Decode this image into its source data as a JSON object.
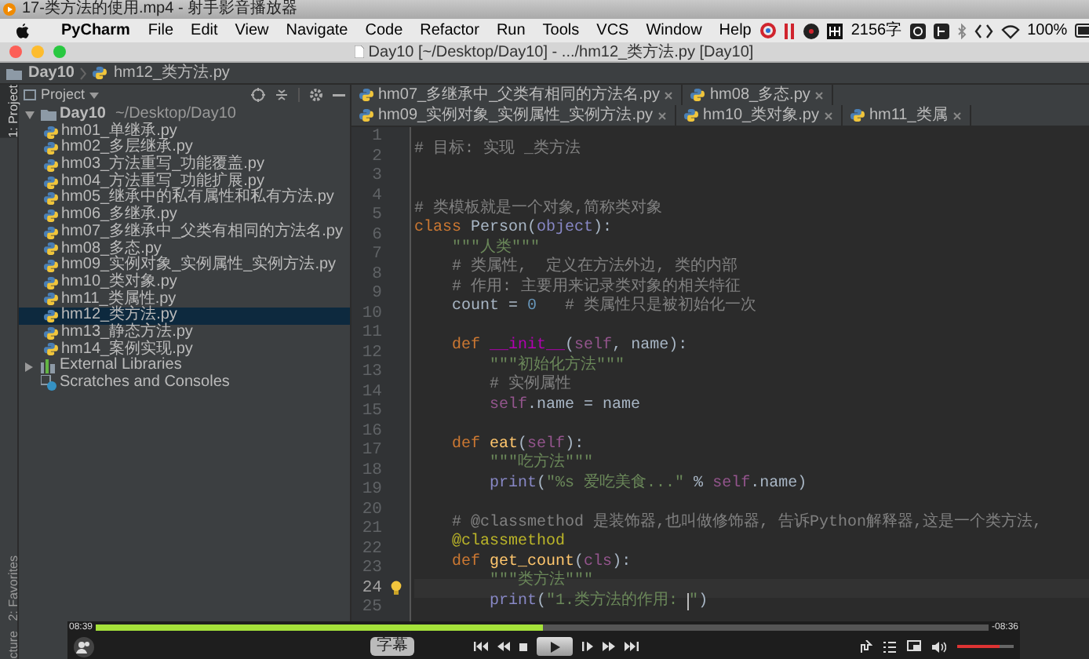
{
  "player_title": "17-类方法的使用.mp4 - 射手影音播放器",
  "menu_bar": {
    "app": "PyCharm",
    "items": [
      "File",
      "Edit",
      "View",
      "Navigate",
      "Code",
      "Refactor",
      "Run",
      "Tools",
      "VCS",
      "Window",
      "Help"
    ],
    "word_count": "2156字",
    "battery": "100%"
  },
  "window": {
    "title": "Day10 [~/Desktop/Day10] - .../hm12_类方法.py [Day10]"
  },
  "breadcrumbs": [
    "Day10",
    "hm12_类方法.py"
  ],
  "side_strip": [
    {
      "label": "1: Project",
      "selected": true
    },
    {
      "label": "2: Favorites",
      "selected": false
    },
    {
      "label": "cture",
      "selected": false
    }
  ],
  "project_panel": {
    "title": "Project",
    "tree": [
      {
        "kind": "folder",
        "label": "Day10",
        "path": "~/Desktop/Day10",
        "expanded": true,
        "selected": false,
        "children": [
          {
            "kind": "python",
            "label": "hm01_单继承.py",
            "selected": false
          },
          {
            "kind": "python",
            "label": "hm02_多层继承.py",
            "selected": false
          },
          {
            "kind": "python",
            "label": "hm03_方法重写_功能覆盖.py",
            "selected": false
          },
          {
            "kind": "python",
            "label": "hm04_方法重写_功能扩展.py",
            "selected": false
          },
          {
            "kind": "python",
            "label": "hm05_继承中的私有属性和私有方法.py",
            "selected": false
          },
          {
            "kind": "python",
            "label": "hm06_多继承.py",
            "selected": false
          },
          {
            "kind": "python",
            "label": "hm07_多继承中_父类有相同的方法名.py",
            "selected": false
          },
          {
            "kind": "python",
            "label": "hm08_多态.py",
            "selected": false
          },
          {
            "kind": "python",
            "label": "hm09_实例对象_实例属性_实例方法.py",
            "selected": false
          },
          {
            "kind": "python",
            "label": "hm10_类对象.py",
            "selected": false
          },
          {
            "kind": "python",
            "label": "hm11_类属性.py",
            "selected": false
          },
          {
            "kind": "python",
            "label": "hm12_类方法.py",
            "selected": true
          },
          {
            "kind": "python",
            "label": "hm13_静态方法.py",
            "selected": false
          },
          {
            "kind": "python",
            "label": "hm14_案例实现.py",
            "selected": false
          }
        ]
      },
      {
        "kind": "library",
        "label": "External Libraries",
        "expanded": false,
        "selected": false
      },
      {
        "kind": "scratches",
        "label": "Scratches and Consoles",
        "selected": false
      }
    ]
  },
  "editor_tabs": [
    {
      "label": "hm07_多继承中_父类有相同的方法名.py",
      "selected": false
    },
    {
      "label": "hm08_多态.py",
      "selected": false
    },
    {
      "label": "hm09_实例对象_实例属性_实例方法.py",
      "selected": false
    },
    {
      "label": "hm10_类对象.py",
      "selected": false
    },
    {
      "label": "hm11_类属",
      "selected": false
    }
  ],
  "code_lines": [
    {
      "number": "1",
      "current": false,
      "tokens": [
        {
          "kind": "comment",
          "text": "# 目标: 实现 _类方法"
        }
      ]
    },
    {
      "number": "2",
      "current": false
    },
    {
      "number": "3",
      "current": false
    },
    {
      "number": "4",
      "current": false,
      "tokens": [
        {
          "kind": "comment",
          "text": "# 类模板就是一个对象,简称类对象"
        }
      ]
    },
    {
      "number": "5",
      "current": false,
      "tokens": [
        {
          "kind": "keyword",
          "text": "class"
        },
        {
          "kind": "plain",
          "text": " Person("
        },
        {
          "kind": "builtin",
          "text": "object"
        },
        {
          "kind": "plain",
          "text": "):"
        }
      ]
    },
    {
      "number": "6",
      "current": false,
      "tokens": [
        {
          "kind": "string",
          "text": "    \"\"\"人类\"\"\""
        }
      ]
    },
    {
      "number": "7",
      "current": false,
      "tokens": [
        {
          "kind": "comment",
          "text": "    # 类属性,  定义在方法外边, 类的内部"
        }
      ]
    },
    {
      "number": "8",
      "current": false,
      "tokens": [
        {
          "kind": "comment",
          "text": "    # 作用: 主要用来记录类对象的相关特征"
        }
      ]
    },
    {
      "number": "9",
      "current": false,
      "tokens": [
        {
          "kind": "plain",
          "text": "    count = "
        },
        {
          "kind": "number",
          "text": "0"
        },
        {
          "kind": "comment",
          "text": "   # 类属性只是被初始化一次"
        }
      ]
    },
    {
      "number": "10",
      "current": false
    },
    {
      "number": "11",
      "current": false,
      "tokens": [
        {
          "kind": "keyword",
          "text": "    def "
        },
        {
          "kind": "magic",
          "text": "__init__"
        },
        {
          "kind": "plain",
          "text": "("
        },
        {
          "kind": "self",
          "text": "self"
        },
        {
          "kind": "plain",
          "text": ", name):"
        }
      ]
    },
    {
      "number": "12",
      "current": false,
      "tokens": [
        {
          "kind": "string",
          "text": "        \"\"\"初始化方法\"\"\""
        }
      ]
    },
    {
      "number": "13",
      "current": false,
      "tokens": [
        {
          "kind": "comment",
          "text": "        # 实例属性"
        }
      ]
    },
    {
      "number": "14",
      "current": false,
      "tokens": [
        {
          "kind": "self",
          "text": "        self"
        },
        {
          "kind": "plain",
          "text": ".name = name"
        }
      ]
    },
    {
      "number": "15",
      "current": false
    },
    {
      "number": "16",
      "current": false,
      "tokens": [
        {
          "kind": "keyword",
          "text": "    def "
        },
        {
          "kind": "function",
          "text": "eat"
        },
        {
          "kind": "plain",
          "text": "("
        },
        {
          "kind": "self",
          "text": "self"
        },
        {
          "kind": "plain",
          "text": "):"
        }
      ]
    },
    {
      "number": "17",
      "current": false,
      "tokens": [
        {
          "kind": "string",
          "text": "        \"\"\"吃方法\"\"\""
        }
      ]
    },
    {
      "number": "18",
      "current": false,
      "tokens": [
        {
          "kind": "builtin",
          "text": "        print"
        },
        {
          "kind": "plain",
          "text": "("
        },
        {
          "kind": "string",
          "text": "\"%s 爱吃美食...\""
        },
        {
          "kind": "plain",
          "text": " % "
        },
        {
          "kind": "self",
          "text": "self"
        },
        {
          "kind": "plain",
          "text": ".name)"
        }
      ]
    },
    {
      "number": "19",
      "current": false
    },
    {
      "number": "20",
      "current": false,
      "tokens": [
        {
          "kind": "comment",
          "text": "    # @classmethod 是装饰器,也叫做修饰器, 告诉Python解释器,这是一个类方法,"
        }
      ]
    },
    {
      "number": "21",
      "current": false,
      "tokens": [
        {
          "kind": "decorator",
          "text": "    @classmethod"
        }
      ]
    },
    {
      "number": "22",
      "current": false,
      "tokens": [
        {
          "kind": "keyword",
          "text": "    def "
        },
        {
          "kind": "function",
          "text": "get_count"
        },
        {
          "kind": "plain",
          "text": "("
        },
        {
          "kind": "self",
          "text": "cls"
        },
        {
          "kind": "plain",
          "text": "):"
        }
      ]
    },
    {
      "number": "23",
      "current": false,
      "tokens": [
        {
          "kind": "string",
          "text": "        \"\"\"类方法\"\"\""
        }
      ]
    },
    {
      "number": "24",
      "current": true,
      "intention_bulb": true,
      "tokens": [
        {
          "kind": "builtin",
          "text": "        print"
        },
        {
          "kind": "plain",
          "text": "("
        },
        {
          "kind": "string",
          "text": "\"1.类方法的作用: "
        },
        {
          "kind": "string",
          "text": "\"",
          "cursor_before": true
        },
        {
          "kind": "plain",
          "text": ")"
        }
      ]
    },
    {
      "number": "25",
      "current": false
    }
  ],
  "player": {
    "elapsed": "08:39",
    "remaining": "-08:36",
    "level": 0.5,
    "subtitle_button": "字幕",
    "volume": {
      "level": 0.75
    }
  }
}
